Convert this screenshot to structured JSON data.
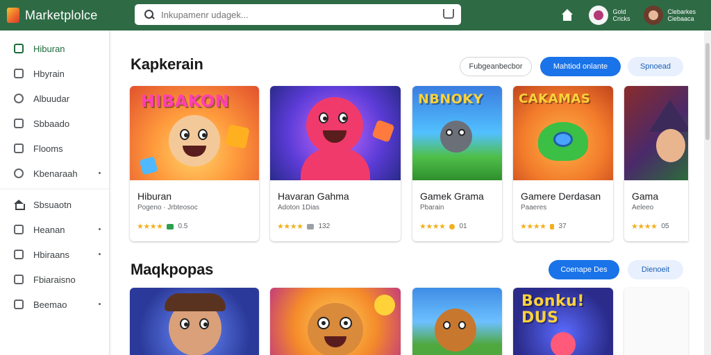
{
  "app": {
    "name": "Marketplolce"
  },
  "search": {
    "placeholder": "Inkupamenr udagek..."
  },
  "header": {
    "users": [
      {
        "line1": "Gold",
        "line2": "Cricks"
      },
      {
        "line1": "Clebarkes",
        "line2": "Ciebaaca"
      }
    ]
  },
  "sidebar": {
    "items": [
      {
        "label": "Hiburan",
        "icon": "store-icon",
        "active": true
      },
      {
        "label": "Hbyrain",
        "icon": "document-icon"
      },
      {
        "label": "Albuudar",
        "icon": "clock-icon"
      },
      {
        "label": "Sbbaado",
        "icon": "image-icon"
      },
      {
        "label": "Flooms",
        "icon": "list-icon"
      },
      {
        "label": "Kbenaraah",
        "icon": "circle-icon",
        "more": true
      },
      {
        "label": "Sbsuaotn",
        "icon": "home-icon"
      },
      {
        "label": "Heanan",
        "icon": "folder-icon",
        "more": true
      },
      {
        "label": "Hbiraans",
        "icon": "tag-icon",
        "more": true
      },
      {
        "label": "Fbiaraisno",
        "icon": "calendar-icon"
      },
      {
        "label": "Beemao",
        "icon": "inbox-icon",
        "more": true
      }
    ]
  },
  "sections": [
    {
      "title": "Kapkerain",
      "chips": [
        "Fubgeanbecbor",
        "Mahtiod onlante",
        "Spnoead"
      ],
      "cards": [
        {
          "title": "Hiburan",
          "subtitle": "Pogeno · Jrbteosoc",
          "rating": "0.5",
          "art_text": "HIBAKON",
          "badge_color": "#2e9e4f"
        },
        {
          "title": "Havaran Gahma",
          "subtitle": "Adoton 1Dias",
          "rating": "132",
          "art_text": "",
          "badge_color": "#9aa0a6"
        },
        {
          "title": "Gamek Grama",
          "subtitle": "Pbarain",
          "rating": "01",
          "art_text": "NBNOKY",
          "badge_color": "#f2b01e"
        },
        {
          "title": "Gamere Derdasan",
          "subtitle": "Paaeres",
          "rating": "37",
          "art_text": "CAKAMAS",
          "badge_color": "#f2b01e"
        },
        {
          "title": "Gama",
          "subtitle": "Aeleeo",
          "rating": "05",
          "art_text": "",
          "badge_color": "#f2b01e"
        }
      ]
    },
    {
      "title": "Maqkpopas",
      "chips": [
        "Coenape Des",
        "Dienoeit"
      ],
      "cards": [
        {
          "art_text": ""
        },
        {
          "art_text": ""
        },
        {
          "art_text": ""
        },
        {
          "art_text": "Bonku! DUS"
        }
      ]
    }
  ],
  "stars": "★★★★",
  "colors": {
    "topbar": "#2e6b45",
    "primary": "#1a73e8",
    "star": "#f2b01e"
  }
}
